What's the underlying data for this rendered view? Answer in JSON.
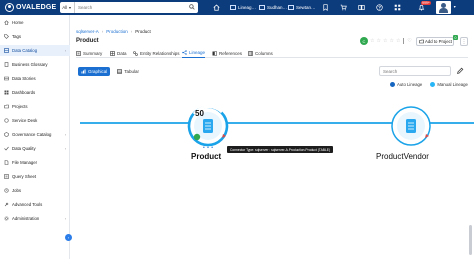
{
  "app": {
    "logo_text": "OVALEDGE",
    "search_scope": "All",
    "search_placeholder": "Search",
    "open_tabs": [
      "Lineag…",
      "Sudhan…",
      "Sewtan…"
    ],
    "notification_badge": "999+"
  },
  "sidebar": {
    "items": [
      {
        "label": "Home",
        "icon": "home-icon",
        "active": false,
        "chevron": false
      },
      {
        "label": "Tags",
        "icon": "tag-icon",
        "active": false,
        "chevron": false
      },
      {
        "label": "Data Catalog",
        "icon": "catalog-icon",
        "active": true,
        "chevron": true
      },
      {
        "label": "Business Glossary",
        "icon": "glossary-icon",
        "active": false,
        "chevron": false
      },
      {
        "label": "Data Stories",
        "icon": "stories-icon",
        "active": false,
        "chevron": false
      },
      {
        "label": "Dashboards",
        "icon": "dashboard-icon",
        "active": false,
        "chevron": false
      },
      {
        "label": "Projects",
        "icon": "projects-icon",
        "active": false,
        "chevron": false
      },
      {
        "label": "Service Desk",
        "icon": "service-desk-icon",
        "active": false,
        "chevron": false
      },
      {
        "label": "Governance Catalog",
        "icon": "governance-icon",
        "active": false,
        "chevron": true
      },
      {
        "label": "Data Quality",
        "icon": "quality-icon",
        "active": false,
        "chevron": true
      },
      {
        "label": "File Manager",
        "icon": "file-icon",
        "active": false,
        "chevron": false
      },
      {
        "label": "Query Sheet",
        "icon": "query-icon",
        "active": false,
        "chevron": false
      },
      {
        "label": "Jobs",
        "icon": "jobs-icon",
        "active": false,
        "chevron": false
      },
      {
        "label": "Advanced Tools",
        "icon": "tools-icon",
        "active": false,
        "chevron": false
      },
      {
        "label": "Administration",
        "icon": "admin-icon",
        "active": false,
        "chevron": true
      }
    ]
  },
  "breadcrumb": {
    "items": [
      "sqlserver-A",
      "Production",
      "Product"
    ]
  },
  "asset": {
    "title": "Product",
    "certify_label": "C",
    "add_to_project_label": "Add to Project",
    "add_to_project_count": "0"
  },
  "tabs": [
    {
      "label": "Summary",
      "icon": "summary-icon",
      "active": false
    },
    {
      "label": "Data",
      "icon": "data-icon",
      "active": false
    },
    {
      "label": "Entity Relationships",
      "icon": "relationship-icon",
      "active": false
    },
    {
      "label": "Lineage",
      "icon": "lineage-icon",
      "active": true
    },
    {
      "label": "References",
      "icon": "references-icon",
      "active": false
    },
    {
      "label": "Columns",
      "icon": "columns-icon",
      "active": false
    }
  ],
  "lineage": {
    "view_options": [
      {
        "label": "Graphical",
        "active": true
      },
      {
        "label": "Tabular",
        "active": false
      }
    ],
    "search_placeholder": "Search",
    "legend": [
      {
        "label": "Auto Lineage",
        "color": "#1565c0"
      },
      {
        "label": "Manual Lineage",
        "color": "#29b6f6"
      }
    ],
    "nodes": [
      {
        "name": "Product",
        "count": "50",
        "selected": true
      },
      {
        "name": "ProductVendor",
        "selected": false
      }
    ],
    "tooltip": "Connector Type: sqlserver : sqlserver-A.Production.Product (TABLE)"
  },
  "colors": {
    "topbar": "#0d3c7d",
    "accent": "#1a6fd1",
    "lineage_line": "#1aa3e8",
    "node_fill": "#29a8f0",
    "certified": "#2fa84f"
  }
}
